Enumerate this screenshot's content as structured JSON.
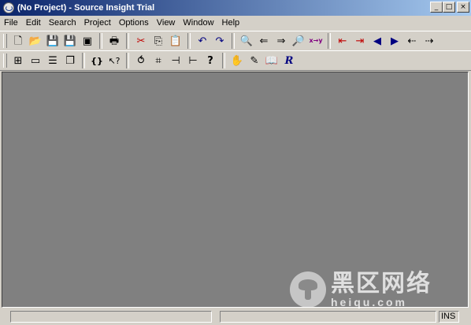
{
  "window": {
    "title": "(No Project) - Source Insight Trial",
    "minimize": "_",
    "maximize": "□",
    "close": "×"
  },
  "menu": [
    "File",
    "Edit",
    "Search",
    "Project",
    "Options",
    "View",
    "Window",
    "Help"
  ],
  "toolbar1": {
    "new": "🗋",
    "open": "📂",
    "save": "💾",
    "save_all": "💾",
    "close": "▣",
    "print": "🖶",
    "cut": "✂",
    "copy": "⎘",
    "paste": "📋",
    "undo": "↶",
    "redo": "↷",
    "search": "🔍",
    "search_backward": "⇐",
    "search_forward": "⇒",
    "search_files": "🔎",
    "replace": "x→y",
    "bookmark_prev": "⇤",
    "bookmark_next": "⇥",
    "go_back": "◀",
    "go_forward": "▶",
    "jump_caller": "⇠",
    "jump_callee": "⇢"
  },
  "toolbar2": {
    "layout1": "⊞",
    "layout2": "▭",
    "layout3": "☰",
    "layout4": "❐",
    "match_braces": "{}",
    "lookup_ref": "↖?",
    "relation": "⥀",
    "browse": "⌗",
    "symbols": "⊣",
    "structure": "⊢",
    "help": "?",
    "project_tools1": "✋",
    "project_tools2": "✎",
    "book": "📖",
    "r_tool": "R"
  },
  "status": {
    "pane1": "",
    "pane2": "",
    "mode": "INS"
  },
  "watermark": {
    "cn": "黑区网络",
    "url": "heiqu.com"
  },
  "colors": {
    "title_start": "#0a246a",
    "title_end": "#a6caf0",
    "chrome": "#d4d0c8",
    "workspace": "#808080"
  }
}
